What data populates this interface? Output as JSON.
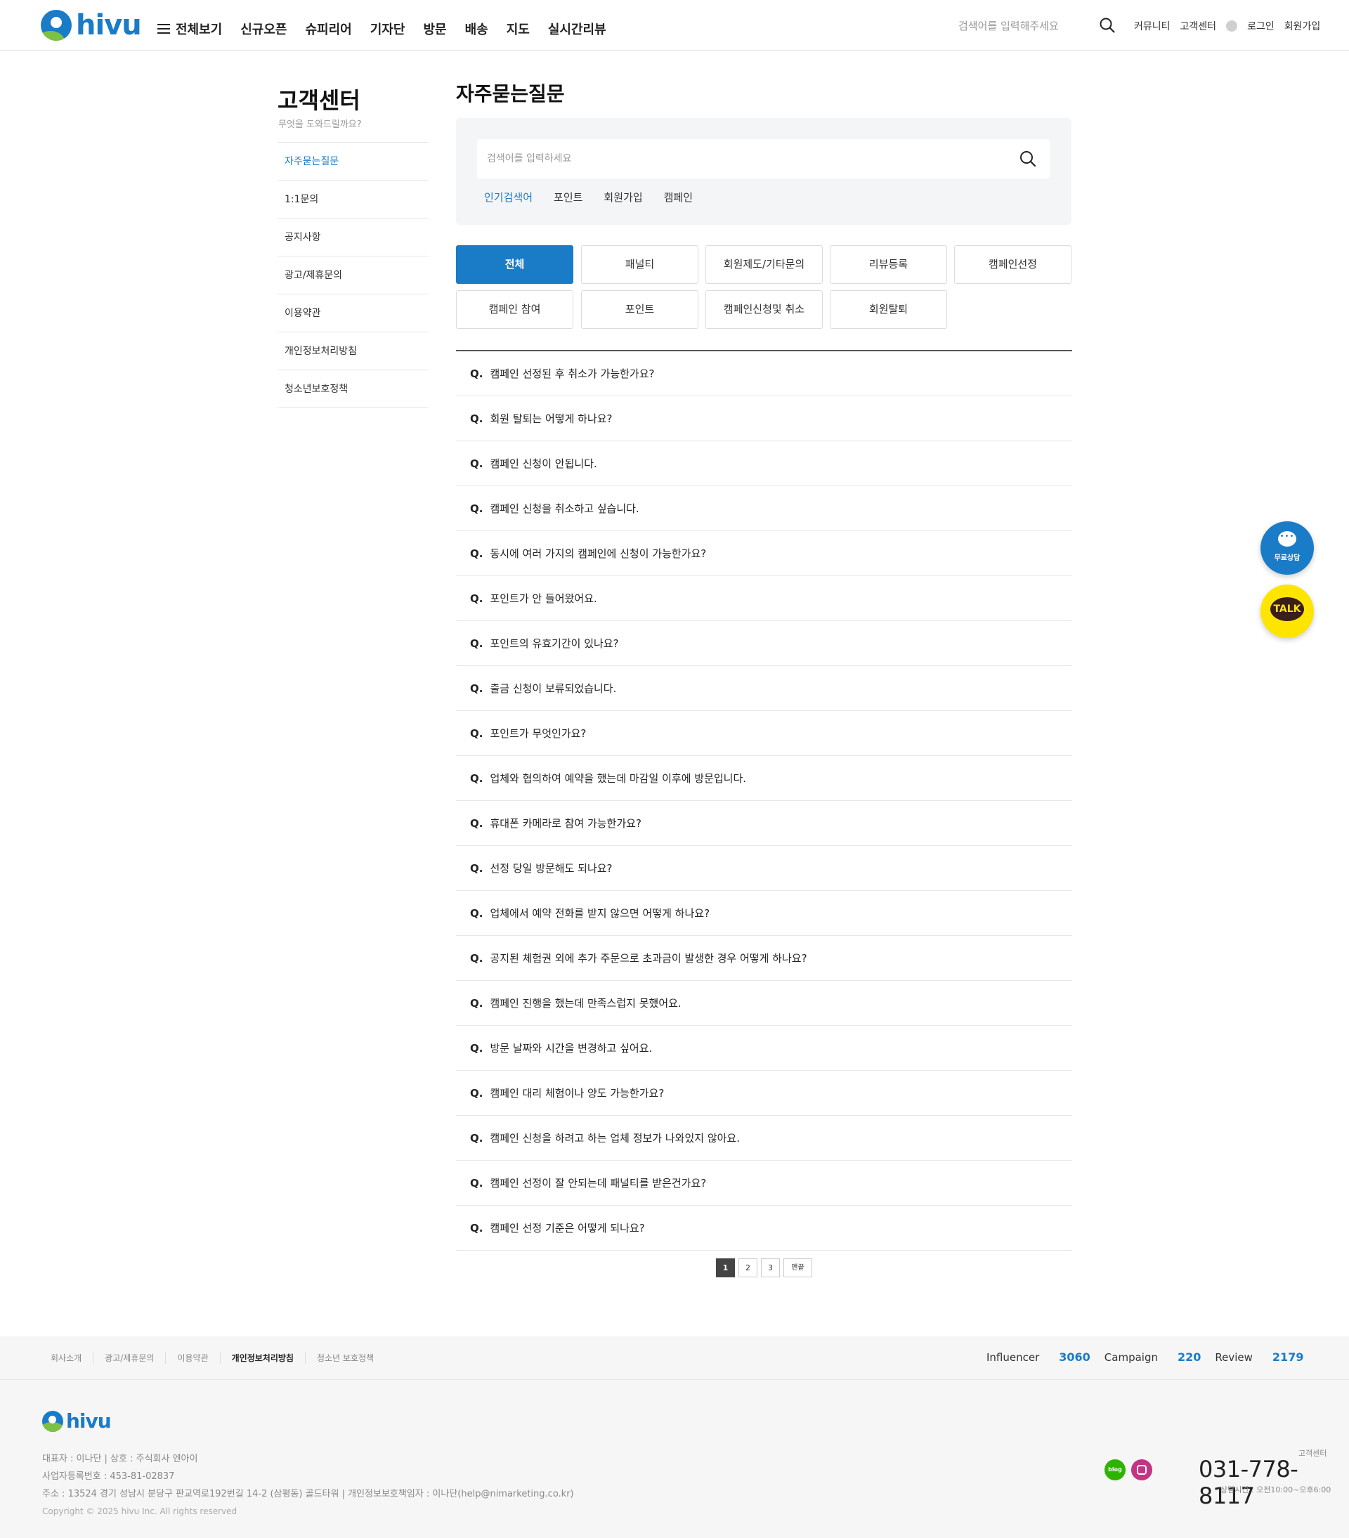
{
  "brand": {
    "name": "hivu",
    "primary": "#1a7bc7",
    "accent": "#7cc142"
  },
  "header": {
    "all_menu": "전체보기",
    "nav": [
      "신규오픈",
      "슈피리어",
      "기자단",
      "방문",
      "배송",
      "지도",
      "실시간리뷰"
    ],
    "search_placeholder": "검색어를 입력해주세요",
    "util": [
      "커뮤니티",
      "고객센터",
      "로그인",
      "회원가입"
    ]
  },
  "sidebar": {
    "title": "고객센터",
    "subtitle": "무엇을 도와드릴까요?",
    "items": [
      "자주묻는질문",
      "1:1문의",
      "공지사항",
      "광고/제휴문의",
      "이용약관",
      "개인정보처리방침",
      "청소년보호정책"
    ],
    "active": "자주묻는질문"
  },
  "main": {
    "title": "자주묻는질문",
    "search_placeholder": "검색어를 입력하세요",
    "popular_label": "인기검색어",
    "popular": [
      "포인트",
      "회원가입",
      "캠페인"
    ],
    "categories": [
      "전체",
      "패널티",
      "회원제도/기타문의",
      "리뷰등록",
      "캠페인선정",
      "캠페인 참여",
      "포인트",
      "캠페인신청및 취소",
      "회원탈퇴"
    ],
    "active_category": "전체",
    "q_mark": "Q.",
    "faqs": [
      "캠페인 선정된 후 취소가 가능한가요?",
      "회원 탈퇴는 어떻게 하나요?",
      "캠페인 신청이 안됩니다.",
      "캠페인 신청을 취소하고 싶습니다.",
      "동시에 여러 가지의 캠페인에 신청이 가능한가요?",
      "포인트가 안 들어왔어요.",
      "포인트의 유효기간이 있나요?",
      "출금 신청이 보류되었습니다.",
      "포인트가 무엇인가요?",
      "업체와 협의하여 예약을 했는데 마감일 이후에 방문입니다.",
      "휴대폰 카메라로 참여 가능한가요?",
      "선정 당일 방문해도 되나요?",
      "업체에서 예약 전화를 받지 않으면 어떻게 하나요?",
      "공지된 체험권 외에 추가 주문으로 초과금이 발생한 경우 어떻게 하나요?",
      "캠페인 진행을 했는데 만족스럽지 못했어요.",
      "방문 날짜와 시간을 변경하고 싶어요.",
      "캠페인 대리 체험이나 양도 가능한가요?",
      "캠페인 신청을 하려고 하는 업체 정보가 나와있지 않아요.",
      "캠페인 선정이 잘 안되는데 패널티를 받은건가요?",
      "캠페인 선정 기준은 어떻게 되나요?"
    ],
    "pagination": [
      "1",
      "2",
      "3",
      "맨끝"
    ],
    "current_page": "1"
  },
  "floating": {
    "chat_label": "무료상담",
    "talk_label": "TALK"
  },
  "footer": {
    "links": [
      "회사소개",
      "광고/제휴문의",
      "이용약관",
      "개인정보처리방침",
      "청소년 보호정책"
    ],
    "stats": [
      {
        "label": "Influencer",
        "value": "3060"
      },
      {
        "label": "Campaign",
        "value": "220"
      },
      {
        "label": "Review",
        "value": "2179"
      }
    ],
    "info_line1": "대표자 : 이나단   |   상호 : 주식회사 엔아이",
    "info_line2": "사업자등록번호 : 453-81-02837",
    "info_line3": "주소 : 13524 경기 성남시 분당구 판교역로192번길 14-2 (삼평동) 골드타워   |   개인정보보호책임자 : 이나단(help@nimarketing.co.kr)",
    "copyright": "Copyright © 2025 hivu Inc. All rights reserved",
    "blog_label": "blog",
    "cs_label": "고객센터",
    "phone": "031-778-8117",
    "hours": "· 상담시간 : 오전10:00~오후6:00"
  }
}
